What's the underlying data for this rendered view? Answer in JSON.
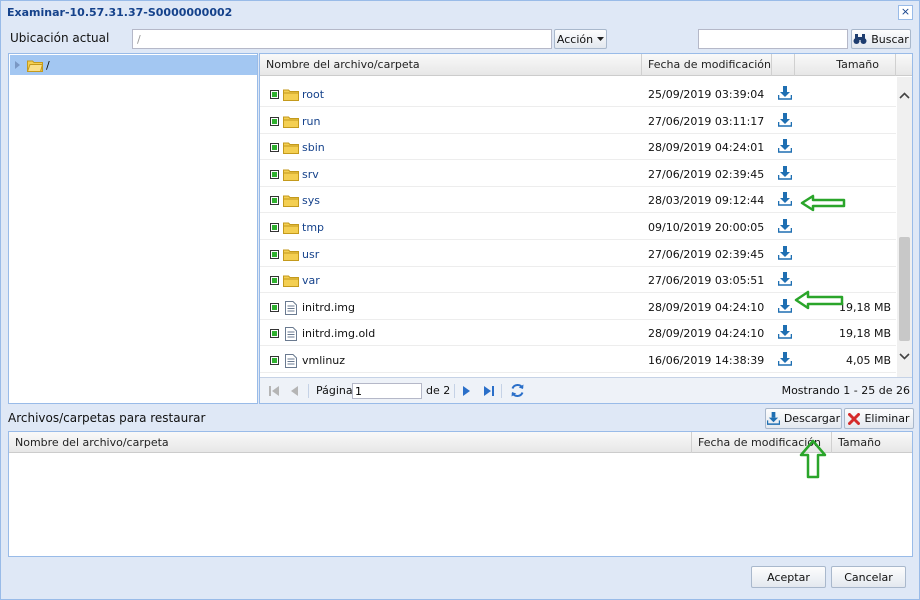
{
  "window": {
    "title": "Examinar-10.57.31.37-S0000000002",
    "close_glyph": "×"
  },
  "location": {
    "label": "Ubicación actual",
    "value": "/",
    "action_label": "Acción"
  },
  "search": {
    "label": "Buscar",
    "value": ""
  },
  "tree": {
    "root_label": "/"
  },
  "columns": {
    "name": "Nombre del archivo/carpeta",
    "date": "Fecha de modificación",
    "size": "Tamaño"
  },
  "files": [
    {
      "name": "root",
      "type": "folder",
      "date": "25/09/2019 03:39:04",
      "size": ""
    },
    {
      "name": "run",
      "type": "folder",
      "date": "27/06/2019 03:11:17",
      "size": ""
    },
    {
      "name": "sbin",
      "type": "folder",
      "date": "28/09/2019 04:24:01",
      "size": ""
    },
    {
      "name": "srv",
      "type": "folder",
      "date": "27/06/2019 02:39:45",
      "size": ""
    },
    {
      "name": "sys",
      "type": "folder",
      "date": "28/03/2019 09:12:44",
      "size": ""
    },
    {
      "name": "tmp",
      "type": "folder",
      "date": "09/10/2019 20:00:05",
      "size": ""
    },
    {
      "name": "usr",
      "type": "folder",
      "date": "27/06/2019 02:39:45",
      "size": ""
    },
    {
      "name": "var",
      "type": "folder",
      "date": "27/06/2019 03:05:51",
      "size": ""
    },
    {
      "name": "initrd.img",
      "type": "file",
      "date": "28/09/2019 04:24:10",
      "size": "19,18 MB"
    },
    {
      "name": "initrd.img.old",
      "type": "file",
      "date": "28/09/2019 04:24:10",
      "size": "19,18 MB"
    },
    {
      "name": "vmlinuz",
      "type": "file",
      "date": "16/06/2019 14:38:39",
      "size": "4,05 MB"
    }
  ],
  "pager": {
    "page_label": "Página",
    "page_value": "1",
    "of_label": "de 2",
    "showing": "Mostrando 1 - 25 de 26"
  },
  "restore": {
    "label": "Archivos/carpetas para restaurar",
    "download_label": "Descargar",
    "delete_label": "Eliminar",
    "col_name": "Nombre del archivo/carpeta",
    "col_date": "Fecha de modificación",
    "col_size": "Tamaño"
  },
  "footer": {
    "accept": "Aceptar",
    "cancel": "Cancelar"
  },
  "colors": {
    "accent": "#15428b",
    "download_icon": "#1f6fb2",
    "highlight_arrow": "#2aa52a",
    "selected_row": "#a3c7f2"
  },
  "icons": [
    "folder-icon",
    "file-icon",
    "download-icon",
    "binoculars-icon",
    "refresh-icon",
    "delete-x-icon"
  ]
}
